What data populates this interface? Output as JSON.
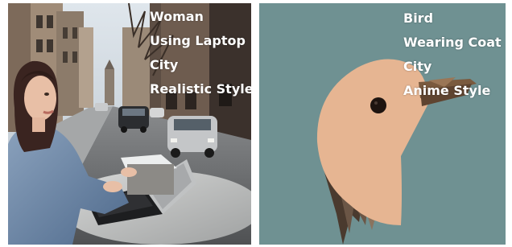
{
  "panels": [
    {
      "id": "left",
      "subject": "photo-woman-laptop-city-street",
      "caption": [
        "Woman",
        "Using Laptop",
        "City",
        "Realistic Style"
      ]
    },
    {
      "id": "right",
      "subject": "anime-bird-head",
      "background_color": "#6f9192",
      "caption": [
        "Bird",
        "Wearing Coat",
        "City",
        "Anime Style"
      ]
    }
  ],
  "colors": {
    "caption_text": "#ffffff",
    "bird_body": "#e6b592",
    "bird_beak": "#7a5a3e",
    "bird_eye": "#1e1410"
  }
}
